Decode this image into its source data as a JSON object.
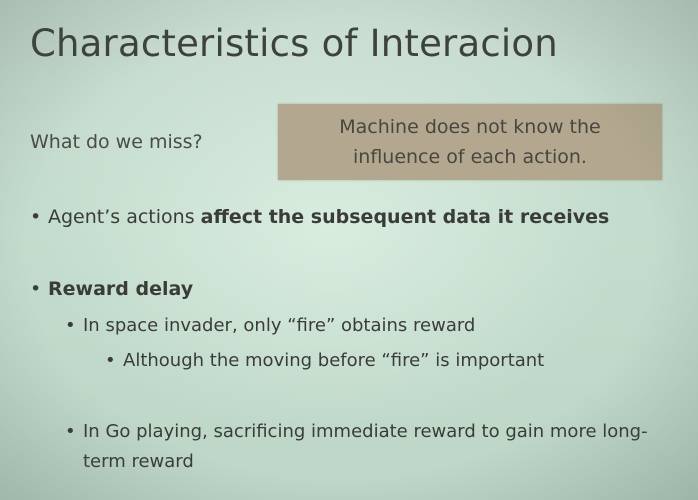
{
  "slide": {
    "title": "Characteristics of Interacion",
    "question": "What do we miss?",
    "callout": {
      "line1": "Machine does not know the",
      "line2": "influence of each action."
    },
    "bullets": [
      {
        "marker": "•",
        "text_plain": "Agent’s actions ",
        "text_bold": "affect the subsequent data it receives"
      },
      {
        "marker": "•",
        "text_bold": "Reward delay"
      },
      {
        "marker": "•",
        "text": "In space invader, only “fire” obtains reward"
      },
      {
        "marker": "•",
        "text": "Although the moving before “fire” is important"
      },
      {
        "marker": "•",
        "text": "In Go playing, sacrificing immediate reward to gain more long-term reward"
      }
    ]
  }
}
